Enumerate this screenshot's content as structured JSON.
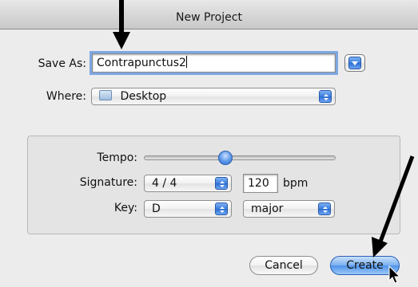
{
  "window": {
    "title": "New Project"
  },
  "save_as": {
    "label": "Save As:",
    "value": "Contrapunctus2"
  },
  "where": {
    "label": "Where:",
    "value": "Desktop",
    "icon": "folder-icon"
  },
  "tempo": {
    "label": "Tempo:",
    "level_fraction": 0.42
  },
  "signature": {
    "label": "Signature:",
    "value": "4 / 4",
    "bpm_value": "120",
    "bpm_unit": "bpm"
  },
  "key": {
    "label": "Key:",
    "note": "D",
    "mode": "major"
  },
  "buttons": {
    "cancel": "Cancel",
    "create": "Create"
  },
  "colors": {
    "accent": "#3a7ddc",
    "annotation_arrow": "#000000"
  }
}
